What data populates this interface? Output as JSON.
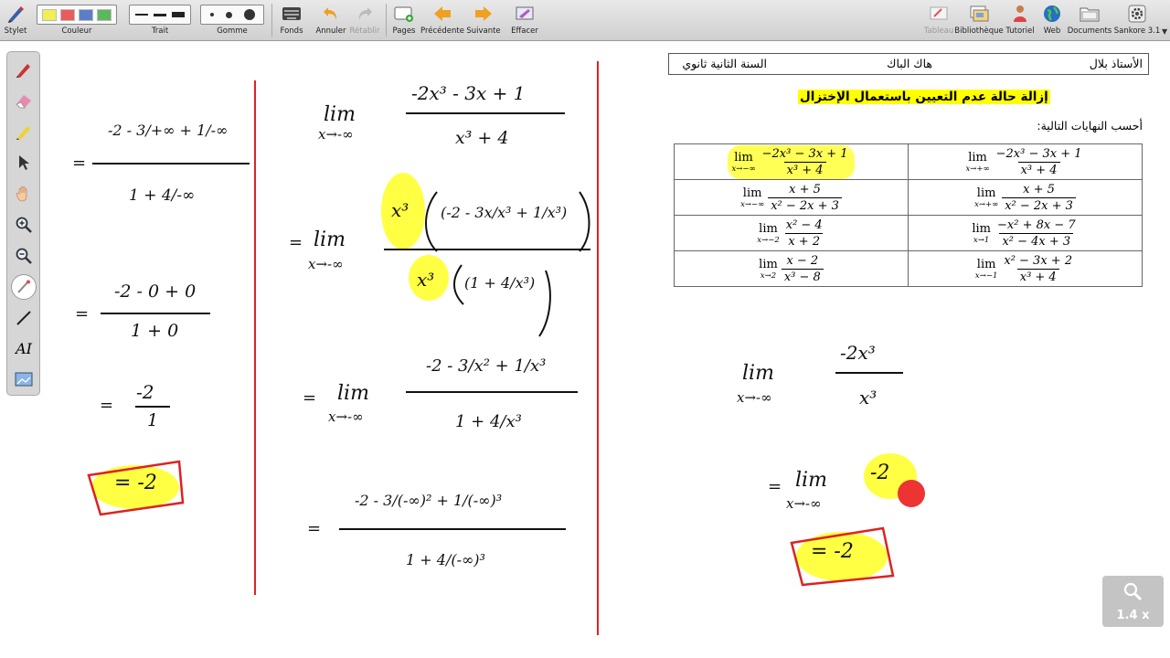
{
  "toolbar": {
    "stylet": "Stylet",
    "couleur": "Couleur",
    "trait": "Trait",
    "gomme": "Gomme",
    "fonds": "Fonds",
    "annuler": "Annuler",
    "retablir": "Rétablir",
    "pages": "Pages",
    "precedente": "Précédente",
    "suivante": "Suivante",
    "effacer": "Effacer",
    "tableau": "Tableau",
    "bibliotheque": "Bibliothèque",
    "tutoriel": "Tutoriel",
    "web": "Web",
    "documents": "Documents",
    "sankore": "Sankore 3.1"
  },
  "colors": {
    "accent_ink": "#d22222",
    "highlight": "#ffff00",
    "swatches": [
      "#f2ee55",
      "#e85c5c",
      "#5c7ec9",
      "#5cb85c"
    ]
  },
  "zoom": {
    "label": "1.4 x"
  },
  "sheet": {
    "teacher": "الأستاذ بلال",
    "source": "هاك الباك",
    "level": "السنة الثانية ثانوي",
    "title": "إزالة حالة عدم التعيين باستعمال الإختزال",
    "instruction": "أحسب النهايات التالية:",
    "limits": [
      {
        "under": "x→−∞",
        "num": "−2x³ − 3x + 1",
        "den": "x³ + 4"
      },
      {
        "under": "x→+∞",
        "num": "−2x³ − 3x + 1",
        "den": "x³ + 4"
      },
      {
        "under": "x→−∞",
        "num": "x + 5",
        "den": "x² − 2x + 3"
      },
      {
        "under": "x→+∞",
        "num": "x + 5",
        "den": "x² − 2x + 3"
      },
      {
        "under": "x→−2",
        "num": "x² − 4",
        "den": "x + 2"
      },
      {
        "under": "x→1",
        "num": "−x² + 8x − 7",
        "den": "x² − 4x + 3"
      },
      {
        "under": "x→2",
        "num": "x − 2",
        "den": "x³ − 8"
      },
      {
        "under": "x→−1",
        "num": "x² − 3x + 2",
        "den": "x³ + 4"
      }
    ]
  },
  "ink": {
    "lim": "lim",
    "a_arrow": "x→-∞",
    "eq": "=",
    "c2_num1": "-2x³ - 3x + 1",
    "c2_den1": "x³ + 4",
    "c2_x3": "x³",
    "c2_paren_top": "(-2 - 3x/x³ + 1/x³)",
    "c2_paren_bot": "(1 + 4/x³)",
    "c2_num3": "-2 - 3/x² + 1/x³",
    "c2_den3": "1 + 4/x³",
    "c2_num4": "-2 - 3/(-∞)² + 1/(-∞)³",
    "c2_den4": "1 + 4/(-∞)³",
    "c1_num1": "-2 - 3/+∞ + 1/-∞",
    "c1_den1": "1 + 4/-∞",
    "c1_num2": "-2 - 0 + 0",
    "c1_den2": "1 + 0",
    "c1_num3": "-2",
    "c1_den3": "1",
    "c1_result": "= -2",
    "r_num": "-2x³",
    "r_den": "x³",
    "r_val": "-2",
    "r_result": "= -2"
  }
}
